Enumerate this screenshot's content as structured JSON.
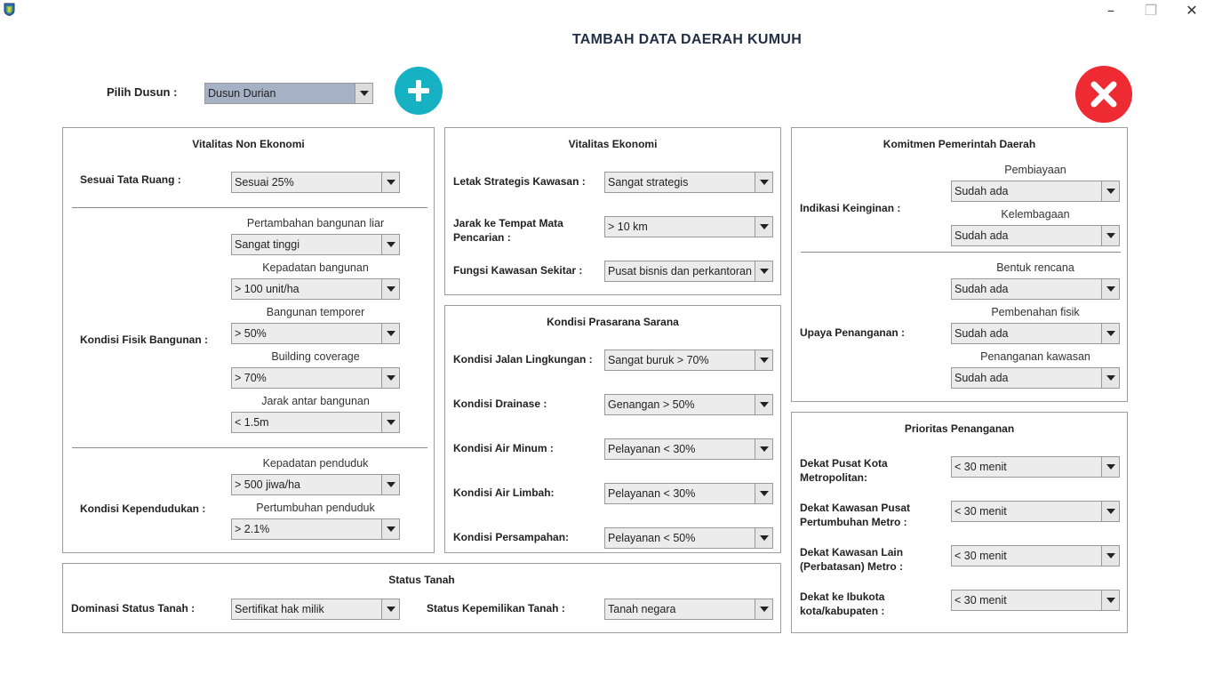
{
  "page_title": "TAMBAH DATA DAERAH KUMUH",
  "window": {
    "minimize": "–",
    "maximize": "❐",
    "close": "✕"
  },
  "dusun": {
    "label": "Pilih Dusun :",
    "value": "Dusun Durian"
  },
  "non_ekonomi": {
    "title": "Vitalitas Non Ekonomi",
    "tata_ruang": {
      "label": "Sesuai Tata Ruang :",
      "value": "Sesuai 25%"
    },
    "fisik": {
      "label": "Kondisi Fisik Bangunan :",
      "liar": {
        "label": "Pertambahan bangunan liar",
        "value": "Sangat tinggi"
      },
      "kepadatan": {
        "label": "Kepadatan bangunan",
        "value": "> 100 unit/ha"
      },
      "temporer": {
        "label": "Bangunan temporer",
        "value": "> 50%"
      },
      "coverage": {
        "label": "Building coverage",
        "value": "> 70%"
      },
      "jarak": {
        "label": "Jarak antar bangunan",
        "value": "< 1.5m"
      }
    },
    "kependudukan": {
      "label": "Kondisi Kependudukan :",
      "kepadatan": {
        "label": "Kepadatan penduduk",
        "value": "> 500 jiwa/ha"
      },
      "pertumbuhan": {
        "label": "Pertumbuhan penduduk",
        "value": "> 2.1%"
      }
    }
  },
  "ekonomi": {
    "title": "Vitalitas Ekonomi",
    "letak": {
      "label": "Letak Strategis Kawasan :",
      "value": "Sangat strategis"
    },
    "jarak": {
      "label": "Jarak ke Tempat Mata Pencarian :",
      "value": "> 10 km"
    },
    "fungsi": {
      "label": "Fungsi Kawasan Sekitar :",
      "value": "Pusat bisnis dan perkantoran"
    }
  },
  "prasarana": {
    "title": "Kondisi Prasarana Sarana",
    "jalan": {
      "label": "Kondisi Jalan Lingkungan :",
      "value": "Sangat buruk > 70%"
    },
    "drainase": {
      "label": "Kondisi Drainase :",
      "value": "Genangan > 50%"
    },
    "air_minum": {
      "label": "Kondisi Air Minum :",
      "value": "Pelayanan < 30%"
    },
    "air_limbah": {
      "label": "Kondisi Air Limbah:",
      "value": "Pelayanan < 30%"
    },
    "persampahan": {
      "label": "Kondisi Persampahan:",
      "value": "Pelayanan < 50%"
    }
  },
  "komitmen": {
    "title": "Komitmen Pemerintah Daerah",
    "indikasi": {
      "label": "Indikasi Keinginan :",
      "pembiayaan": {
        "label": "Pembiayaan",
        "value": "Sudah ada"
      },
      "kelembagaan": {
        "label": "Kelembagaan",
        "value": "Sudah ada"
      }
    },
    "upaya": {
      "label": "Upaya Penanganan :",
      "rencana": {
        "label": "Bentuk rencana",
        "value": "Sudah ada"
      },
      "fisik": {
        "label": "Pembenahan fisik",
        "value": "Sudah ada"
      },
      "kawasan": {
        "label": "Penanganan kawasan",
        "value": "Sudah ada"
      }
    }
  },
  "prioritas": {
    "title": "Prioritas Penanganan",
    "metro": {
      "label_1": "Dekat Pusat Kota",
      "label_2": "Metropolitan:",
      "value": "< 30 menit"
    },
    "pertumbuhan": {
      "label_1": "Dekat Kawasan Pusat",
      "label_2": "Pertumbuhan Metro :",
      "value": "< 30 menit"
    },
    "lain": {
      "label_1": "Dekat Kawasan Lain",
      "label_2": "(Perbatasan) Metro :",
      "value": "< 30 menit"
    },
    "ibukota": {
      "label_1": "Dekat ke Ibukota",
      "label_2": "kota/kabupaten :",
      "value": "< 30 menit"
    }
  },
  "status_tanah": {
    "title": "Status Tanah",
    "dominasi": {
      "label": "Dominasi Status Tanah :",
      "value": "Sertifikat hak milik"
    },
    "kepemilikan": {
      "label": "Status Kepemilikan Tanah :",
      "value": "Tanah negara"
    }
  },
  "colors": {
    "add": "#17b1c4",
    "close": "#ee2a33",
    "dusun_combo": "#a7b1c5",
    "title": "#1f2f44"
  },
  "icons": {
    "add": "plus-icon",
    "close": "x-icon",
    "dropdown": "chevron-down-icon"
  }
}
